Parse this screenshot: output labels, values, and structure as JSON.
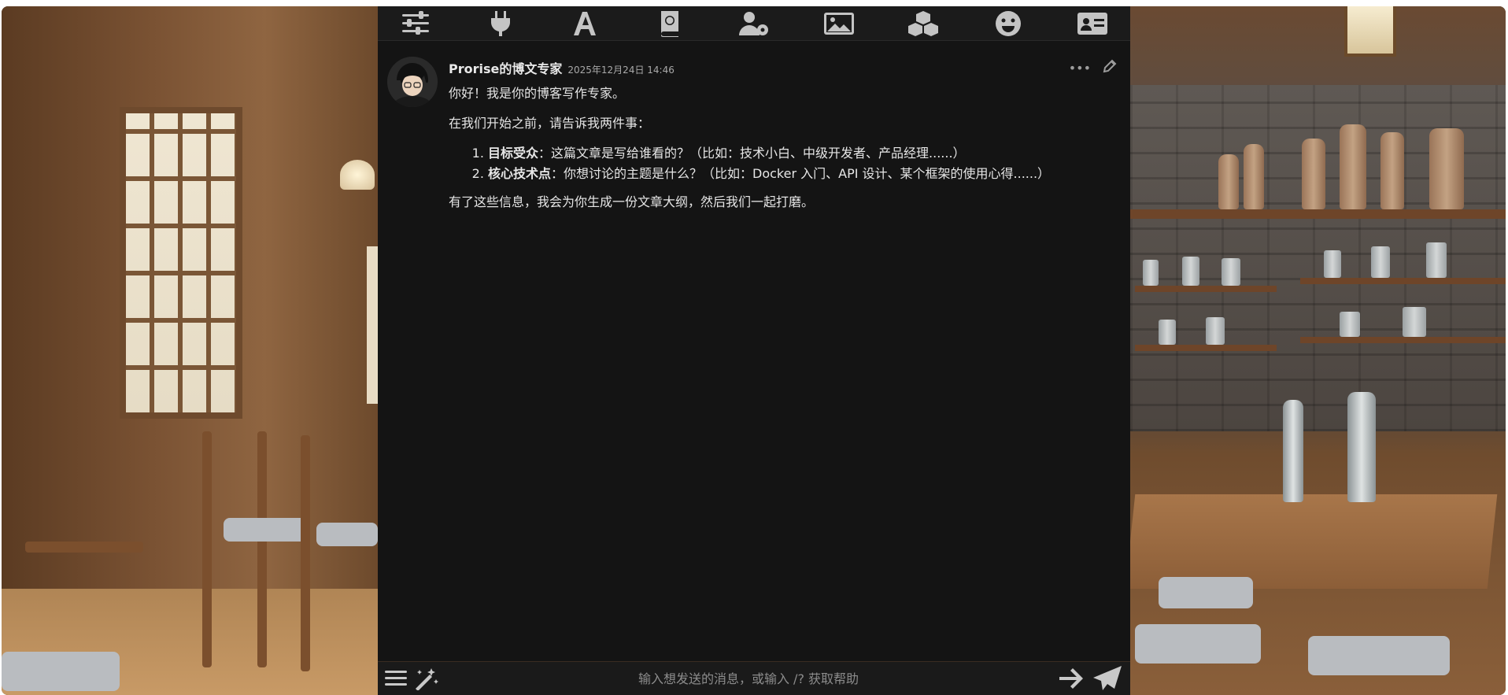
{
  "topbar": {
    "icons": [
      {
        "name": "sliders-icon"
      },
      {
        "name": "plug-icon"
      },
      {
        "name": "font-icon"
      },
      {
        "name": "book-icon"
      },
      {
        "name": "user-gear-icon"
      },
      {
        "name": "image-icon"
      },
      {
        "name": "cubes-icon"
      },
      {
        "name": "smile-icon"
      },
      {
        "name": "id-card-icon"
      }
    ]
  },
  "message": {
    "sender": "Prorise的博文专家",
    "timestamp": "2025年12月24日 14:46",
    "greeting": "你好！我是你的博客写作专家。",
    "intro": "在我们开始之前，请告诉我两件事：",
    "items": [
      {
        "label": "目标受众",
        "text": "：这篇文章是写给谁看的？（比如：技术小白、中级开发者、产品经理......）"
      },
      {
        "label": "核心技术点",
        "text": "：你想讨论的主题是什么？（比如：Docker 入门、API 设计、某个框架的使用心得......）"
      }
    ],
    "outro": "有了这些信息，我会为你生成一份文章大纲，然后我们一起打磨。",
    "more_label": "•••"
  },
  "input": {
    "placeholder": "输入想发送的消息，或输入 /? 获取帮助",
    "value": ""
  },
  "colors": {
    "panel_bg": "#141414",
    "text": "#e6e6e6",
    "icon": "#c4c4c4"
  }
}
